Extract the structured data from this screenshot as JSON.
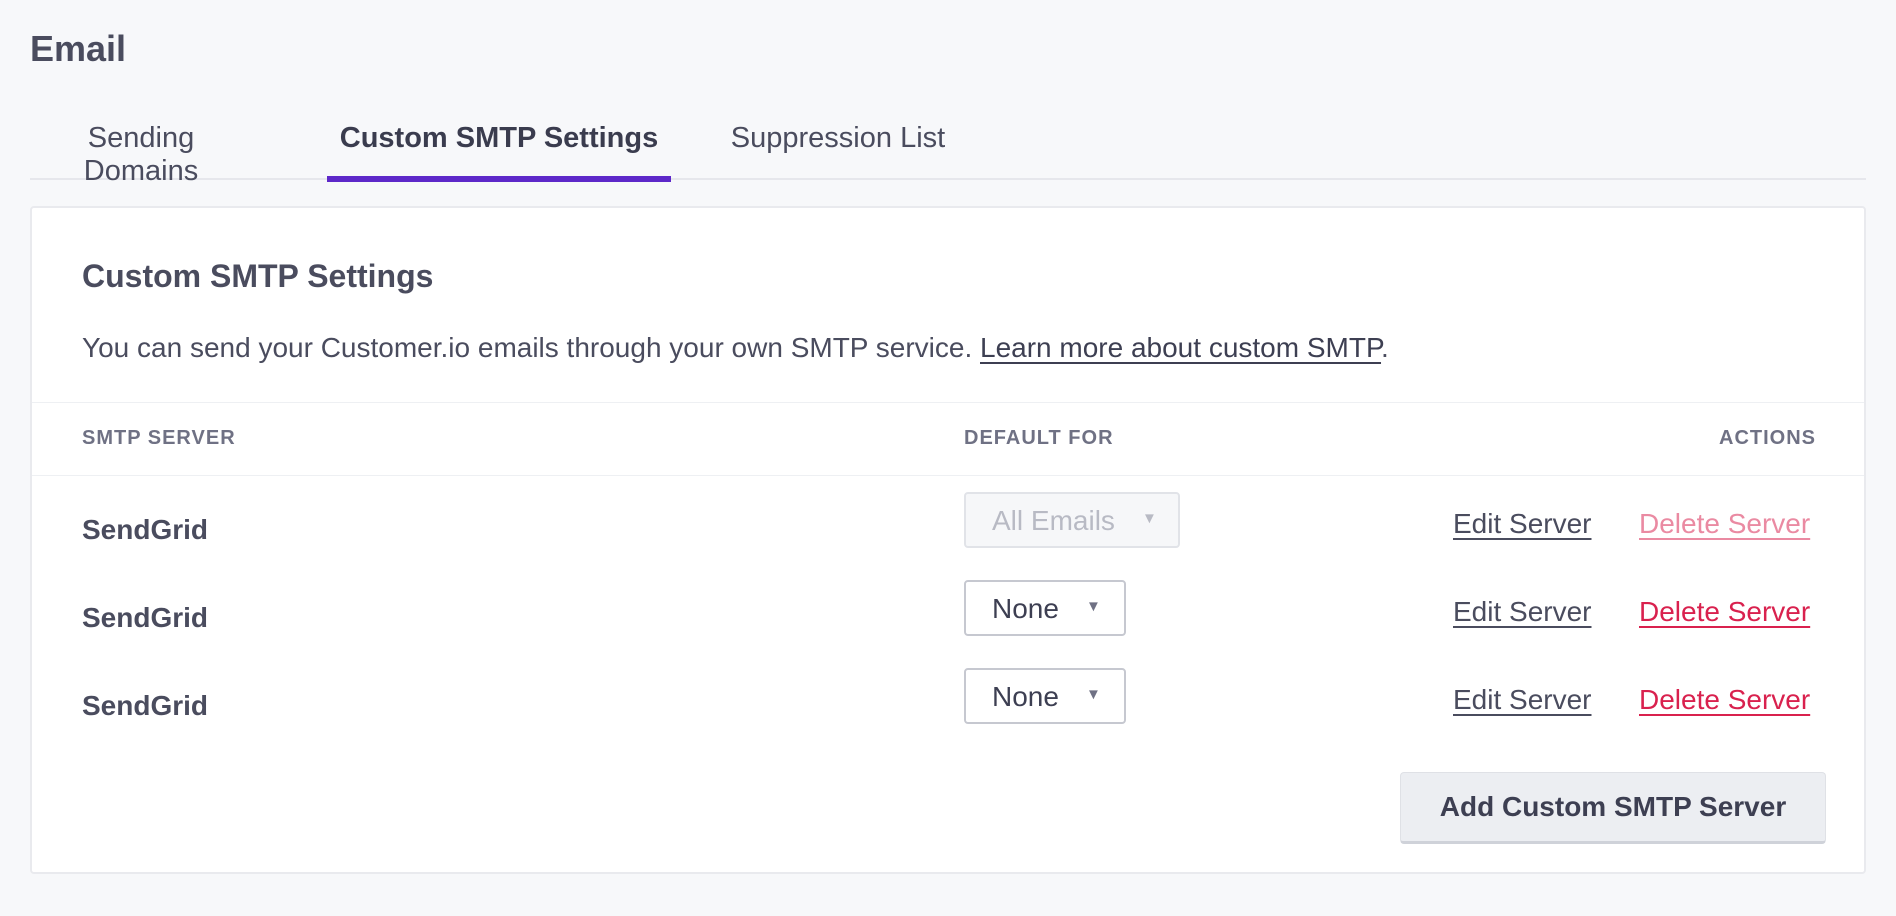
{
  "page": {
    "title": "Email"
  },
  "tabs": [
    {
      "label": "Sending Domains",
      "active": false
    },
    {
      "label": "Custom SMTP Settings",
      "active": true
    },
    {
      "label": "Suppression List",
      "active": false
    }
  ],
  "accent_color": "#5d28c9",
  "danger_color": "#d9214e",
  "card": {
    "title": "Custom SMTP Settings",
    "description": "You can send your Customer.io emails through your own SMTP service.",
    "link_text": "Learn more about custom SMTP",
    "link_suffix": "."
  },
  "table": {
    "columns": [
      "SMTP SERVER",
      "DEFAULT FOR",
      "ACTIONS"
    ],
    "rows": [
      {
        "server": "SendGrid",
        "default_for": "All Emails",
        "default_disabled": true,
        "edit_label": "Edit Server",
        "delete_label": "Delete Server",
        "delete_disabled": true
      },
      {
        "server": "SendGrid",
        "default_for": "None",
        "default_disabled": false,
        "edit_label": "Edit Server",
        "delete_label": "Delete Server",
        "delete_disabled": false
      },
      {
        "server": "SendGrid",
        "default_for": "None",
        "default_disabled": false,
        "edit_label": "Edit Server",
        "delete_label": "Delete Server",
        "delete_disabled": false
      }
    ]
  },
  "add_button_label": "Add Custom SMTP Server",
  "icons": {
    "caret": "caret-down-icon"
  }
}
